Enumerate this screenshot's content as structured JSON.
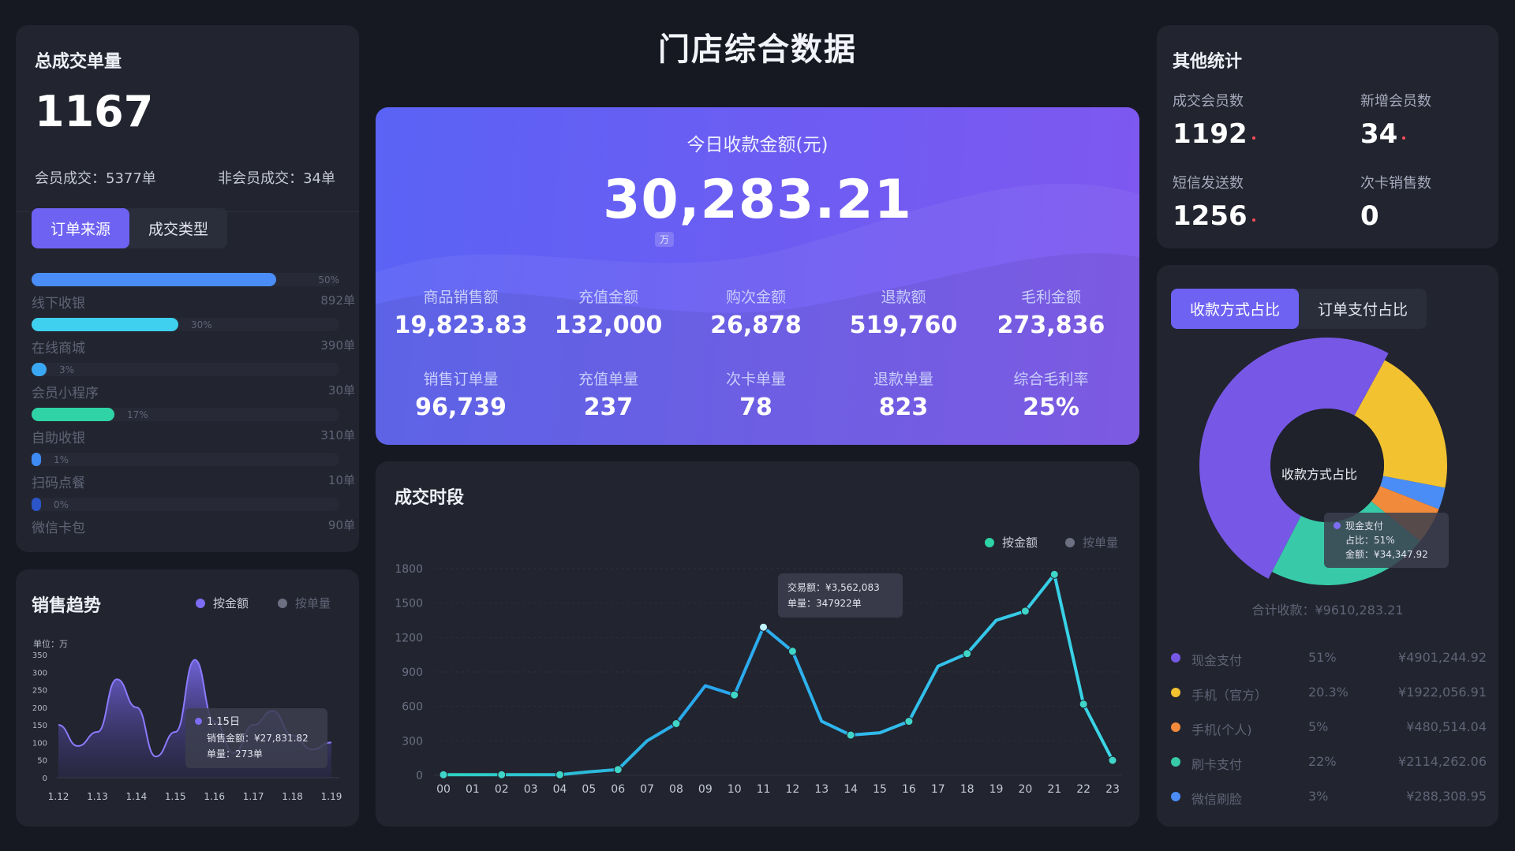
{
  "page_title": "门店综合数据",
  "total": {
    "title": "总成交单量",
    "value": "1167",
    "member_text": "会员成交：5377单",
    "nonmember_text": "非会员成交：34单",
    "tabs": [
      "订单来源",
      "成交类型"
    ],
    "sources": [
      {
        "label": "线下收银",
        "pct": 0.5,
        "pct_text": "50%",
        "count": "892单",
        "color": "#4a8df6"
      },
      {
        "label": "在线商城",
        "pct": 0.3,
        "pct_text": "30%",
        "count": "390单",
        "color": "#3fd0ef"
      },
      {
        "label": "会员小程序",
        "pct": 0.03,
        "pct_text": "3%",
        "count": "30单",
        "color": "#3aa7f2"
      },
      {
        "label": "自助收银",
        "pct": 0.17,
        "pct_text": "17%",
        "count": "310单",
        "color": "#2fd3a6"
      },
      {
        "label": "扫码点餐",
        "pct": 0.01,
        "pct_text": "1%",
        "count": "10单",
        "color": "#3f8bf4"
      },
      {
        "label": "微信卡包",
        "pct": 0.0,
        "pct_text": "0%",
        "count": "90单",
        "color": "#2b55c8"
      }
    ]
  },
  "trend": {
    "title": "销售趋势",
    "legend": [
      {
        "label": "按金额",
        "color": "#7d6cf4"
      },
      {
        "label": "按单量",
        "color": "#6c7082"
      }
    ],
    "unit_label": "单位：万",
    "tooltip": {
      "date": "1.15日",
      "line1": "销售金额：¥27,831.82",
      "line2": "单量：273单"
    }
  },
  "hero": {
    "caption": "今日收款金额(元)",
    "value": "30,283.21",
    "unit": "万",
    "kpis": [
      {
        "label": "商品销售额",
        "value": "19,823.83"
      },
      {
        "label": "充值金额",
        "value": "132,000"
      },
      {
        "label": "购次金额",
        "value": "26,878"
      },
      {
        "label": "退款额",
        "value": "519,760"
      },
      {
        "label": "毛利金额",
        "value": "273,836"
      },
      {
        "label": "销售订单量",
        "value": "96,739"
      },
      {
        "label": "充值单量",
        "value": "237"
      },
      {
        "label": "次卡单量",
        "value": "78"
      },
      {
        "label": "退款单量",
        "value": "823"
      },
      {
        "label": "综合毛利率",
        "value": "25%"
      }
    ]
  },
  "timeline": {
    "title": "成交时段",
    "legend": [
      {
        "label": "按金额",
        "color": "#2fd3a6"
      },
      {
        "label": "按单量",
        "color": "#6c7082"
      }
    ],
    "tooltip": {
      "line1": "交易额：¥3,562,083",
      "line2": "单量：347922单"
    }
  },
  "other": {
    "title": "其他统计",
    "stats": [
      {
        "label": "成交会员数",
        "value": "1192"
      },
      {
        "label": "新增会员数",
        "value": "34"
      },
      {
        "label": "短信发送数",
        "value": "1256"
      },
      {
        "label": "次卡销售数",
        "value": "0"
      }
    ]
  },
  "pay": {
    "tabs": [
      "收款方式占比",
      "订单支付占比"
    ],
    "center_label": "收款方式占比",
    "tooltip": {
      "name": "现金支付",
      "line1": "占比：51%",
      "line2": "金额：¥34,347.92"
    },
    "total_text": "合计收款：¥9610,283.21",
    "rows": [
      {
        "name": "现金支付",
        "pct_text": "51%",
        "pct": 51,
        "amount": "¥4901,244.92",
        "color": "#7758e6"
      },
      {
        "name": "手机（官方）",
        "pct_text": "20.3%",
        "pct": 20.3,
        "amount": "¥1922,056.91",
        "color": "#f2c230"
      },
      {
        "name": "手机(个人)",
        "pct_text": "5%",
        "pct": 5,
        "amount": "¥480,514.04",
        "color": "#f28a3c"
      },
      {
        "name": "刷卡支付",
        "pct_text": "22%",
        "pct": 22,
        "amount": "¥2114,262.06",
        "color": "#38c9a9"
      },
      {
        "name": "微信刷脸",
        "pct_text": "3%",
        "pct": 3,
        "amount": "¥288,308.95",
        "color": "#4a8df6"
      }
    ]
  },
  "chart_data": [
    {
      "type": "area",
      "title": "销售趋势",
      "ylabel": "单位：万",
      "categories": [
        "1.12",
        "1.13",
        "1.14",
        "1.15",
        "1.16",
        "1.17",
        "1.18",
        "1.19"
      ],
      "yticks": [
        0,
        50,
        100,
        150,
        200,
        250,
        300,
        350
      ],
      "ylim": [
        0,
        350
      ],
      "x": [
        1.12,
        1.125,
        1.13,
        1.135,
        1.14,
        1.145,
        1.15,
        1.155,
        1.16,
        1.165,
        1.17,
        1.175,
        1.18,
        1.185,
        1.19
      ],
      "values": [
        150,
        90,
        130,
        280,
        200,
        60,
        130,
        335,
        160,
        70,
        150,
        190,
        120,
        80,
        100
      ],
      "series": [
        {
          "name": "按金额",
          "values": [
            150,
            90,
            130,
            280,
            200,
            60,
            130,
            335,
            160,
            70,
            150,
            190,
            120,
            80,
            100
          ]
        }
      ]
    },
    {
      "type": "line",
      "title": "成交时段",
      "categories": [
        "00",
        "01",
        "02",
        "03",
        "04",
        "05",
        "06",
        "07",
        "08",
        "09",
        "10",
        "11",
        "12",
        "13",
        "14",
        "15",
        "16",
        "17",
        "18",
        "19",
        "20",
        "21",
        "22",
        "23"
      ],
      "yticks": [
        0,
        300,
        600,
        900,
        1200,
        1500,
        1800
      ],
      "ylim": [
        0,
        1800
      ],
      "series": [
        {
          "name": "按金额",
          "values": [
            5,
            5,
            5,
            5,
            5,
            30,
            50,
            300,
            450,
            780,
            700,
            1290,
            1080,
            470,
            350,
            370,
            470,
            950,
            1060,
            1350,
            1430,
            1750,
            620,
            130
          ]
        }
      ]
    },
    {
      "type": "pie",
      "title": "收款方式占比",
      "categories": [
        "现金支付",
        "手机（官方）",
        "手机(个人)",
        "刷卡支付",
        "微信刷脸"
      ],
      "values": [
        51,
        20.3,
        5,
        22,
        3
      ]
    }
  ]
}
